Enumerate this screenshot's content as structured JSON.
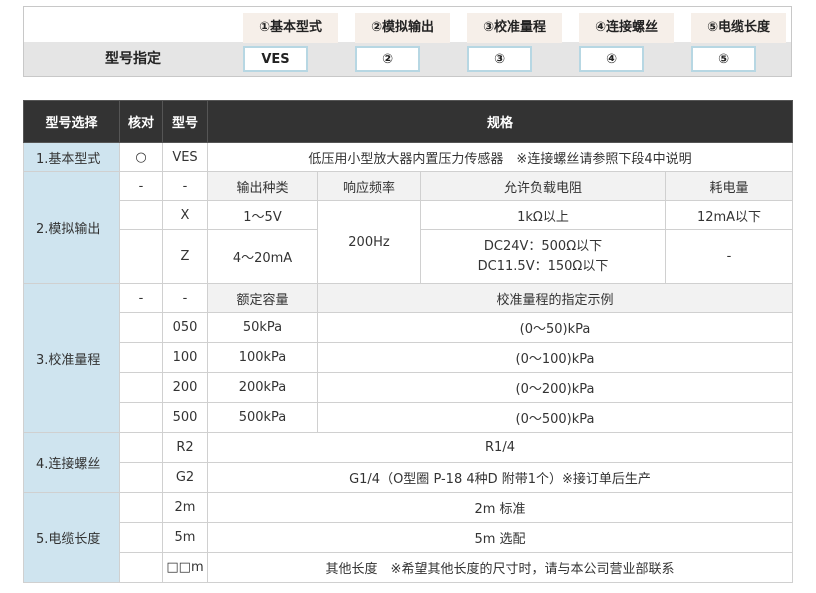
{
  "model": {
    "title": "型号指定",
    "headers": [
      "①基本型式",
      "②模拟输出",
      "③校准量程",
      "④连接螺丝",
      "⑤电缆长度"
    ],
    "slots": [
      "VES",
      "②",
      "③",
      "④",
      "⑤"
    ]
  },
  "table": {
    "headers": [
      "型号选择",
      "核对",
      "型号",
      "规格"
    ],
    "basic": {
      "category": "1.基本型式",
      "check": "○",
      "code": "VES",
      "spec": "低压用小型放大器内置压力传感器　※连接螺丝请参照下段4中说明"
    },
    "analog": {
      "category": "2.模拟输出",
      "sub_check": "-",
      "sub_code": "-",
      "sub_headers": [
        "输出种类",
        "响应频率",
        "允许负载电阻",
        "耗电量"
      ],
      "rows": [
        {
          "code": "X",
          "output": "1～5V",
          "load": "1kΩ以上",
          "power": "12mA以下"
        },
        {
          "code": "Z",
          "output": "4～20mA",
          "load_line1": "DC24V：500Ω以下",
          "load_line2": "DC11.5V：150Ω以下",
          "power": "-"
        }
      ],
      "frequency": "200Hz"
    },
    "range": {
      "category": "3.校准量程",
      "sub_check": "-",
      "sub_code": "-",
      "sub_headers": [
        "额定容量",
        "校准量程的指定示例"
      ],
      "rows": [
        {
          "code": "050",
          "capacity": "50kPa",
          "example": "(0～50)kPa"
        },
        {
          "code": "100",
          "capacity": "100kPa",
          "example": "(0～100)kPa"
        },
        {
          "code": "200",
          "capacity": "200kPa",
          "example": "(0～200)kPa"
        },
        {
          "code": "500",
          "capacity": "500kPa",
          "example": "(0～500)kPa"
        }
      ]
    },
    "thread": {
      "category": "4.连接螺丝",
      "rows": [
        {
          "code": "R2",
          "spec": "R1/4"
        },
        {
          "code": "G2",
          "spec": "G1/4（O型圈 P-18 4种D 附带1个）※接订单后生产"
        }
      ]
    },
    "cable": {
      "category": "5.电缆长度",
      "rows": [
        {
          "code": "2m",
          "spec": "2m 标准"
        },
        {
          "code": "5m",
          "spec": "5m 选配"
        },
        {
          "code": "□□m",
          "spec": "其他长度　※希望其他长度的尺寸时，请与本公司营业部联系"
        }
      ]
    }
  }
}
